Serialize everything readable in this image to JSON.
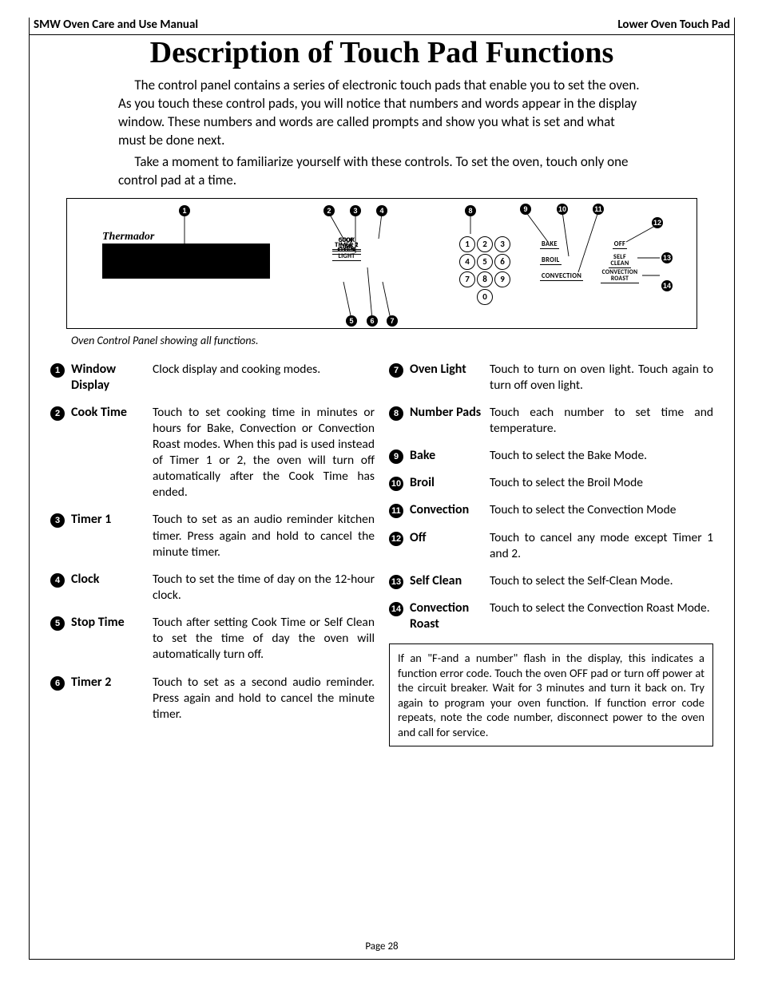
{
  "header": {
    "left": "SMW Oven Care and Use Manual",
    "right": "Lower Oven Touch Pad"
  },
  "title": "Description of Touch Pad Functions",
  "intro": {
    "p1": "The control panel contains a series of electronic touch pads that enable you to set the oven.  As you touch these control pads, you will notice that numbers and words appear in the display window.  These numbers and words are called prompts and show you what is set and what must be done next.",
    "p2": "Take a moment to familiarize yourself with these controls.  To set the oven, touch only one control pad at a time."
  },
  "panel": {
    "brand": "Thermador",
    "labels": {
      "cook_time": "COOK\nTIME",
      "stop_time": "STOP\nTIME",
      "timer1": "TIMER 1",
      "timer2": "TIMER 2",
      "clock": "CLOCK",
      "oven_light": "OVEN\nLIGHT",
      "bake": "BAKE",
      "broil": "BROIL",
      "convection": "CONVECTION",
      "off": "OFF",
      "self_clean": "SELF\nCLEAN",
      "conv_roast": "CONVECTION\nROAST"
    },
    "numpad": [
      "1",
      "2",
      "3",
      "4",
      "5",
      "6",
      "7",
      "8",
      "9",
      "0"
    ],
    "caption": "Oven Control Panel showing all functions."
  },
  "items": [
    {
      "n": "1",
      "term": "Window Display",
      "desc": "Clock display and cooking modes."
    },
    {
      "n": "2",
      "term": "Cook Time",
      "desc": "Touch to set cooking time in minutes or hours for Bake, Convection or Convection Roast modes.  When this pad is used instead of Timer 1 or 2, the oven will turn off automatically after the Cook Time has ended."
    },
    {
      "n": "3",
      "term": "Timer 1",
      "desc": "Touch to set as an audio reminder kitchen timer.  Press again and hold to cancel the minute timer."
    },
    {
      "n": "4",
      "term": "Clock",
      "desc": "Touch to set the time of day on the 12-hour clock."
    },
    {
      "n": "5",
      "term": "Stop Time",
      "desc": "Touch after setting Cook Time or Self Clean to set the time of day the oven will automatically turn off."
    },
    {
      "n": "6",
      "term": "Timer 2",
      "desc": "Touch to set as a second audio reminder.  Press again and hold to cancel the minute timer."
    },
    {
      "n": "7",
      "term": "Oven Light",
      "desc": "Touch to turn on oven light.  Touch again to turn off oven light."
    },
    {
      "n": "8",
      "term": "Number Pads",
      "desc": "Touch each number to set time and temperature."
    },
    {
      "n": "9",
      "term": "Bake",
      "desc": "Touch to select the Bake Mode."
    },
    {
      "n": "10",
      "term": "Broil",
      "desc": "Touch to select the Broil Mode"
    },
    {
      "n": "11",
      "term": "Convection",
      "desc": "Touch to select the Convection Mode"
    },
    {
      "n": "12",
      "term": "Off",
      "desc": "Touch to cancel any mode except Timer 1 and 2."
    },
    {
      "n": "13",
      "term": "Self Clean",
      "desc": "Touch to select the Self-Clean Mode."
    },
    {
      "n": "14",
      "term": "Convection Roast",
      "desc": "Touch to select the Convection Roast Mode."
    }
  ],
  "error_note": "If an \"F-and a number\" flash in the display, this indicates a function error code.  Touch the oven OFF pad or turn off power at the circuit breaker.  Wait for 3 minutes and turn it back on.  Try again to program your oven function. If function error code repeats, note the code number, disconnect power to the oven and call for service.",
  "page_number": "Page 28"
}
